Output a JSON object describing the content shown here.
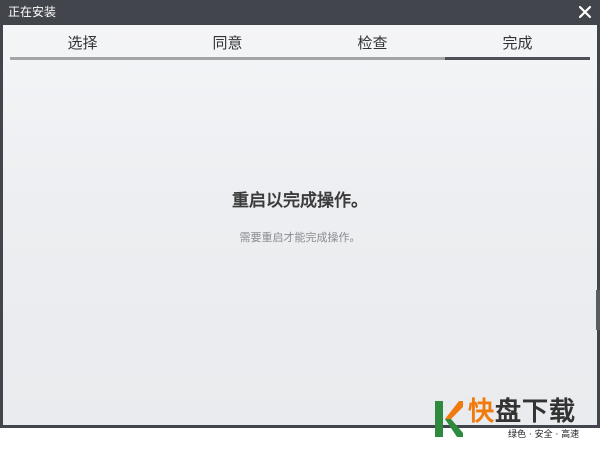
{
  "window": {
    "title": "正在安装"
  },
  "tabs": [
    {
      "label": "选择",
      "active": false
    },
    {
      "label": "同意",
      "active": false
    },
    {
      "label": "检查",
      "active": false
    },
    {
      "label": "完成",
      "active": true
    }
  ],
  "main": {
    "heading": "重启以完成操作。",
    "subtext": "需要重启才能完成操作。"
  },
  "watermark": {
    "brand_first": "快",
    "brand_rest": "盘下载",
    "tagline": "绿色 · 安全 · 高速"
  },
  "colors": {
    "titlebar": "#43454d",
    "tab_bar": "#a3a5a9",
    "tab_bar_active": "#4d5057",
    "brand_orange": "#f07a0c",
    "brand_green": "#2e8b3e"
  },
  "icons": {
    "close": "close-icon",
    "logo": "k-logo-icon"
  }
}
